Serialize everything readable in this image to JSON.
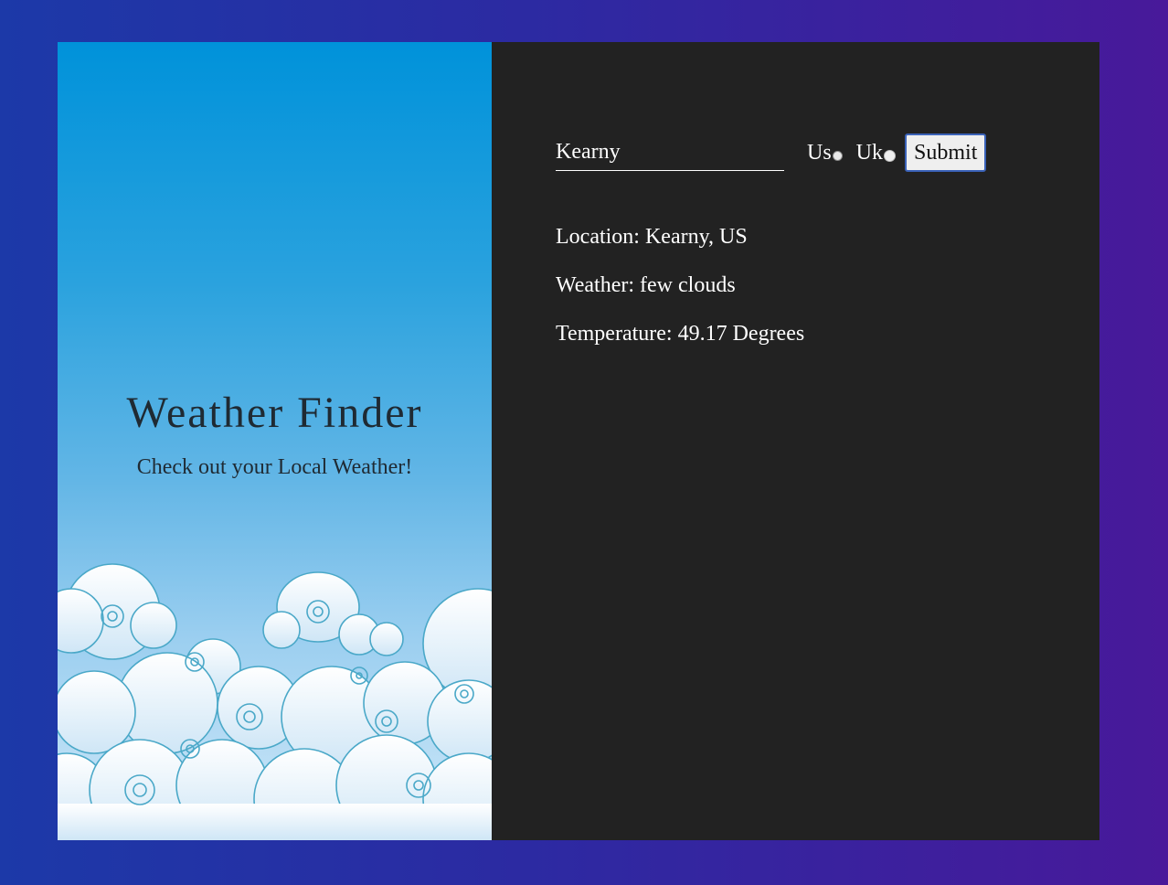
{
  "app": {
    "title": "Weather Finder",
    "subtitle": "Check out your Local Weather!"
  },
  "form": {
    "city_value": "Kearny",
    "radio_us_label": "Us",
    "radio_uk_label": "Uk",
    "selected_unit": "Uk",
    "submit_label": "Submit"
  },
  "results": {
    "location": "Location: Kearny, US",
    "weather": "Weather: few clouds",
    "temperature": "Temperature: 49.17 Degrees"
  },
  "colors": {
    "background_start": "#1c39a8",
    "background_end": "#48199a",
    "left_panel_top": "#0092da",
    "right_panel": "#222222",
    "cloud_stroke": "#4aa8c8"
  },
  "icons": {
    "clouds": "clouds-illustration"
  }
}
